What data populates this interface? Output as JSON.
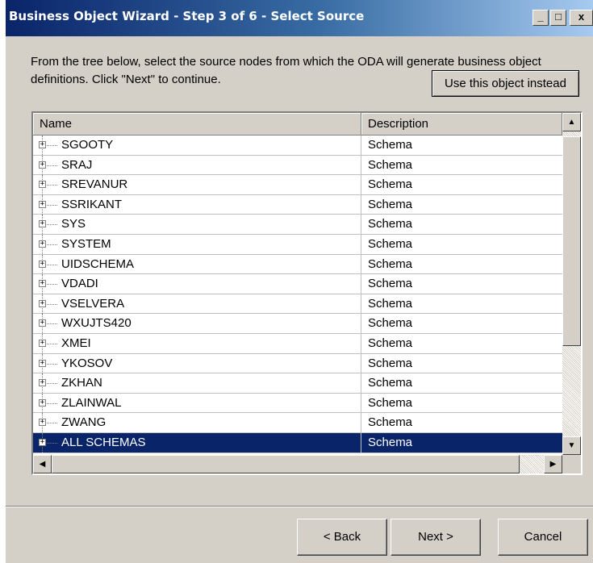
{
  "window": {
    "title": "Business Object Wizard - Step 3 of 6 - Select Source",
    "minimize": "_",
    "maximize": "□",
    "close": "x"
  },
  "instruction": "From the tree below, select the source nodes from which the ODA will generate business object definitions. Click \"Next\" to continue.",
  "use_object_button": "Use this object instead",
  "tree": {
    "columns": {
      "name": "Name",
      "description": "Description"
    },
    "rows": [
      {
        "name": "SGOOTY",
        "description": "Schema"
      },
      {
        "name": "SRAJ",
        "description": "Schema"
      },
      {
        "name": "SREVANUR",
        "description": "Schema"
      },
      {
        "name": "SSRIKANT",
        "description": "Schema"
      },
      {
        "name": "SYS",
        "description": "Schema"
      },
      {
        "name": "SYSTEM",
        "description": "Schema"
      },
      {
        "name": "UIDSCHEMA",
        "description": "Schema"
      },
      {
        "name": "VDADI",
        "description": "Schema"
      },
      {
        "name": "VSELVERA",
        "description": "Schema"
      },
      {
        "name": "WXUJTS420",
        "description": "Schema"
      },
      {
        "name": "XMEI",
        "description": "Schema"
      },
      {
        "name": "YKOSOV",
        "description": "Schema"
      },
      {
        "name": "ZKHAN",
        "description": "Schema"
      },
      {
        "name": "ZLAINWAL",
        "description": "Schema"
      },
      {
        "name": "ZWANG",
        "description": "Schema"
      },
      {
        "name": "ALL SCHEMAS",
        "description": "Schema",
        "selected": true
      }
    ],
    "expander": "+"
  },
  "buttons": {
    "back": "< Back",
    "next": "Next >",
    "cancel": "Cancel"
  },
  "scroll_arrows": {
    "up": "▲",
    "down": "▼",
    "left": "◀",
    "right": "▶"
  }
}
